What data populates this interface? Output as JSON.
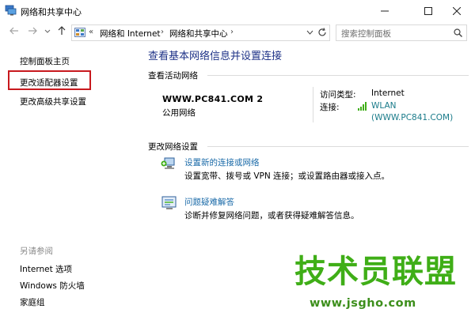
{
  "window": {
    "title": "网络和共享中心",
    "controls": [
      "minimize",
      "maximize",
      "close"
    ]
  },
  "address_bar": {
    "back_icon": "arrow-left-icon",
    "forward_icon": "arrow-right-icon",
    "recent_icon": "chevron-down-icon",
    "up_icon": "arrow-up-icon",
    "overflow": "«",
    "breadcrumbs": [
      "网络和 Internet",
      "网络和共享中心"
    ],
    "search_placeholder": "搜索控制面板"
  },
  "sidebar": {
    "items": [
      {
        "label": "控制面板主页"
      },
      {
        "label": "更改适配器设置",
        "highlighted": true
      },
      {
        "label": "更改高级共享设置"
      }
    ],
    "see_also_label": "另请参阅",
    "see_also": [
      {
        "label": "Internet 选项"
      },
      {
        "label": "Windows 防火墙"
      },
      {
        "label": "家庭组"
      }
    ]
  },
  "main": {
    "title": "查看基本网络信息并设置连接",
    "active_networks_title": "查看活动网络",
    "network": {
      "name": "WWW.PC841.COM  2",
      "type": "公用网络",
      "access_type_label": "访问类型:",
      "access_type_value": "Internet",
      "connection_label": "连接:",
      "connection_value": "WLAN",
      "connection_detail": "(WWW.PC841.COM)"
    },
    "change_settings_title": "更改网络设置",
    "actions": [
      {
        "link": "设置新的连接或网络",
        "description": "设置宽带、拨号或 VPN 连接；或设置路由器或接入点。",
        "icon": "new-connection-icon"
      },
      {
        "link": "问题疑难解答",
        "description": "诊断并修复网络问题，或者获得疑难解答信息。",
        "icon": "troubleshoot-icon"
      }
    ]
  },
  "watermark": {
    "text": "技术员联盟",
    "url": "www.jsgho.com"
  },
  "colors": {
    "title_blue": "#1e3287",
    "link_blue": "#1a6aa8",
    "link_teal": "#1a7b8a",
    "highlight_red": "#c8191e",
    "watermark_green": "#3fae17"
  }
}
